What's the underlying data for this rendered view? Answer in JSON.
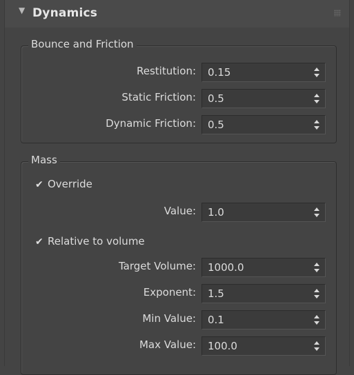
{
  "rollout": {
    "title": "Dynamics"
  },
  "bounce_friction": {
    "title": "Bounce and Friction",
    "rows": [
      {
        "label": "Restitution:",
        "value": "0.15"
      },
      {
        "label": "Static Friction:",
        "value": "0.5"
      },
      {
        "label": "Dynamic Friction:",
        "value": "0.5"
      }
    ]
  },
  "mass": {
    "title": "Mass",
    "override": {
      "label": "Override",
      "checked": true
    },
    "value_row": {
      "label": "Value:",
      "value": "1.0"
    },
    "relative": {
      "label": "Relative to volume",
      "checked": true
    },
    "rows": [
      {
        "label": "Target Volume:",
        "value": "1000.0"
      },
      {
        "label": "Exponent:",
        "value": "1.5"
      },
      {
        "label": "Min Value:",
        "value": "0.1"
      },
      {
        "label": "Max Value:",
        "value": "100.0"
      }
    ]
  }
}
